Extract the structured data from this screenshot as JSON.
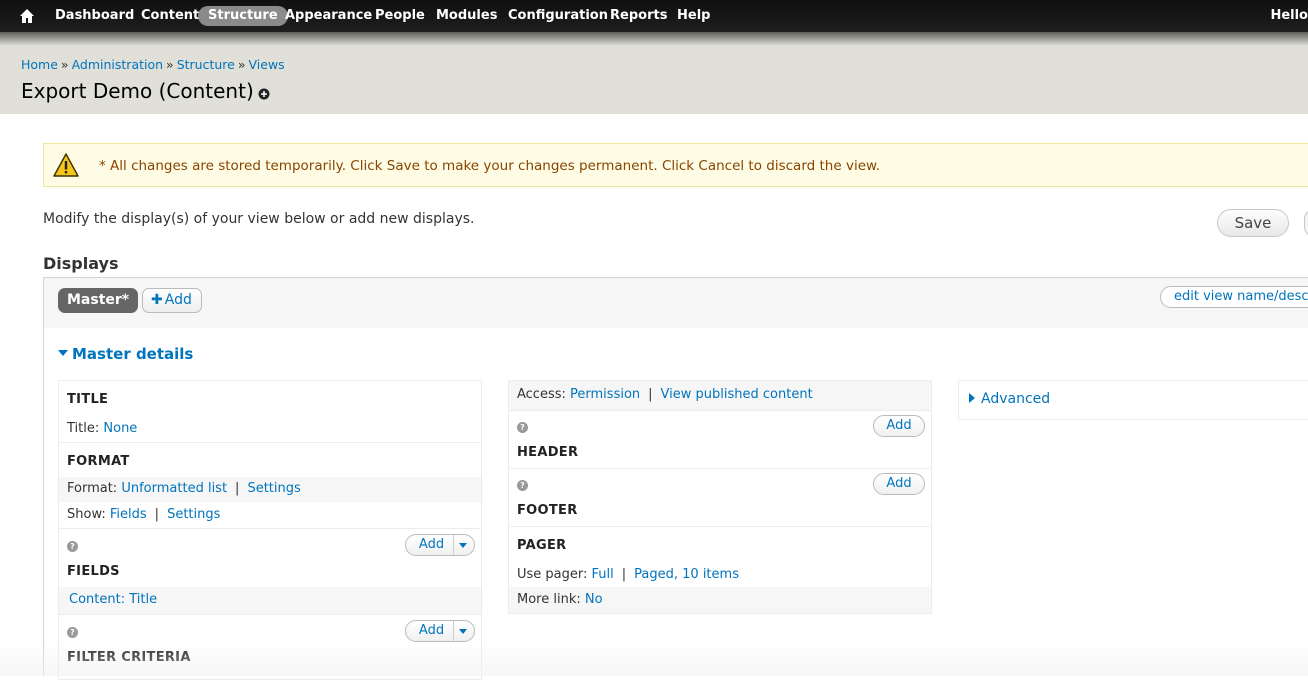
{
  "toolbar": {
    "items": [
      "Dashboard",
      "Content",
      "Structure",
      "Appearance",
      "People",
      "Modules",
      "Configuration",
      "Reports",
      "Help"
    ],
    "active": "Structure",
    "user_greeting": "Hello"
  },
  "breadcrumb": [
    "Home",
    "Administration",
    "Structure",
    "Views"
  ],
  "breadcrumb_separator": "»",
  "page_title": "Export Demo (Content)",
  "warning_message": "* All changes are stored temporarily. Click Save to make your changes permanent. Click Cancel to discard the view.",
  "intro_text": "Modify the display(s) of your view below or add new displays.",
  "save_label": "Save",
  "displays": {
    "heading": "Displays",
    "master_tab": "Master*",
    "add_label": "Add",
    "edit_name_label": "edit view name/description"
  },
  "master_details_label": "Master details",
  "column1": {
    "title_section": {
      "heading": "TITLE",
      "label": "Title:",
      "value": "None"
    },
    "format_section": {
      "heading": "FORMAT",
      "format_label": "Format:",
      "format_value": "Unformatted list",
      "format_settings": "Settings",
      "show_label": "Show:",
      "show_value": "Fields",
      "show_settings": "Settings"
    },
    "fields_section": {
      "heading": "FIELDS",
      "add_label": "Add",
      "items": [
        "Content: Title"
      ]
    },
    "filter_section": {
      "heading": "FILTER CRITERIA",
      "add_label": "Add"
    }
  },
  "column2": {
    "access": {
      "label": "Access:",
      "value": "Permission",
      "detail": "View published content"
    },
    "header_section": {
      "heading": "HEADER",
      "add_label": "Add"
    },
    "footer_section": {
      "heading": "FOOTER",
      "add_label": "Add"
    },
    "pager_section": {
      "heading": "PAGER",
      "use_pager_label": "Use pager:",
      "use_pager_value": "Full",
      "use_pager_detail": "Paged, 10 items",
      "more_link_label": "More link:",
      "more_link_value": "No"
    }
  },
  "column3": {
    "advanced_label": "Advanced"
  },
  "colors": {
    "link": "#0074bd",
    "toolbar_bg": "#0f0f0f",
    "header_bg": "#e0e0d8",
    "warning_bg": "#fffce5",
    "active_tab": "#666666"
  }
}
